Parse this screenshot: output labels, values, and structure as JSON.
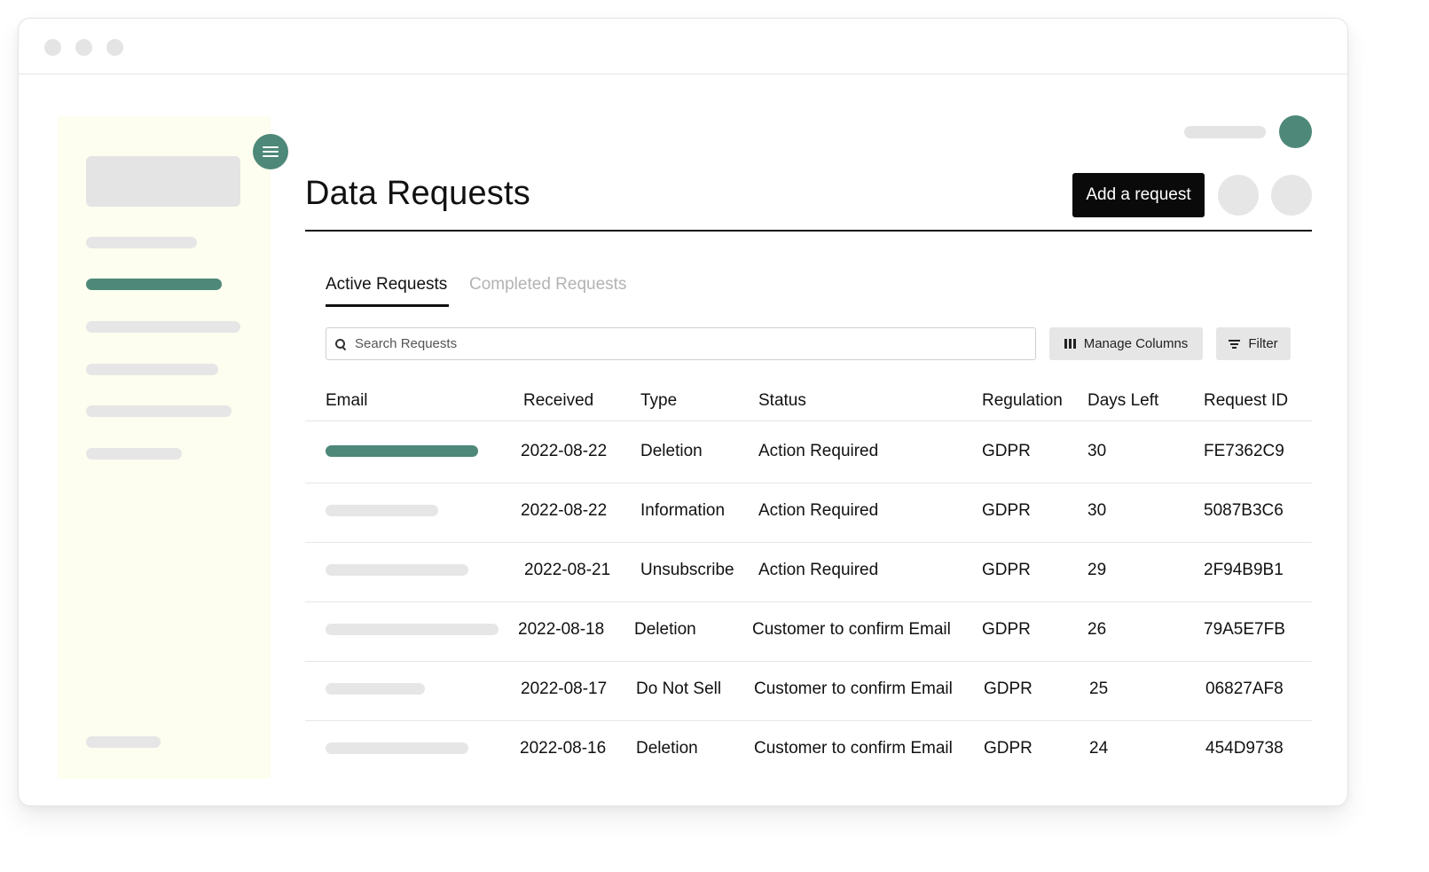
{
  "app": {
    "accent_color": "#4d8878"
  },
  "header": {
    "title": "Data Requests",
    "add_button_label": "Add a request"
  },
  "tabs": [
    {
      "label": "Active Requests",
      "active": true
    },
    {
      "label": "Completed Requests",
      "active": false
    }
  ],
  "toolbar": {
    "search_placeholder": "Search Requests",
    "manage_columns_label": "Manage Columns",
    "filter_label": "Filter"
  },
  "table": {
    "columns": [
      "Email",
      "Received",
      "Type",
      "Status",
      "Regulation",
      "Days Left",
      "Request ID"
    ],
    "rows": [
      {
        "received": "2022-08-22",
        "type": "Deletion",
        "status": "Action Required",
        "regulation": "GDPR",
        "days_left": "30",
        "request_id": "FE7362C9"
      },
      {
        "received": "2022-08-22",
        "type": "Information",
        "status": "Action Required",
        "regulation": "GDPR",
        "days_left": "30",
        "request_id": "5087B3C6"
      },
      {
        "received": "2022-08-21",
        "type": "Unsubscribe",
        "status": "Action Required",
        "regulation": "GDPR",
        "days_left": "29",
        "request_id": "2F94B9B1"
      },
      {
        "received": "2022-08-18",
        "type": "Deletion",
        "status": "Customer to confirm Email",
        "regulation": "GDPR",
        "days_left": "26",
        "request_id": "79A5E7FB"
      },
      {
        "received": "2022-08-17",
        "type": "Do Not Sell",
        "status": "Customer to confirm Email",
        "regulation": "GDPR",
        "days_left": "25",
        "request_id": "06827AF8"
      },
      {
        "received": "2022-08-16",
        "type": "Deletion",
        "status": "Customer to confirm Email",
        "regulation": "GDPR",
        "days_left": "24",
        "request_id": "454D9738"
      }
    ]
  }
}
